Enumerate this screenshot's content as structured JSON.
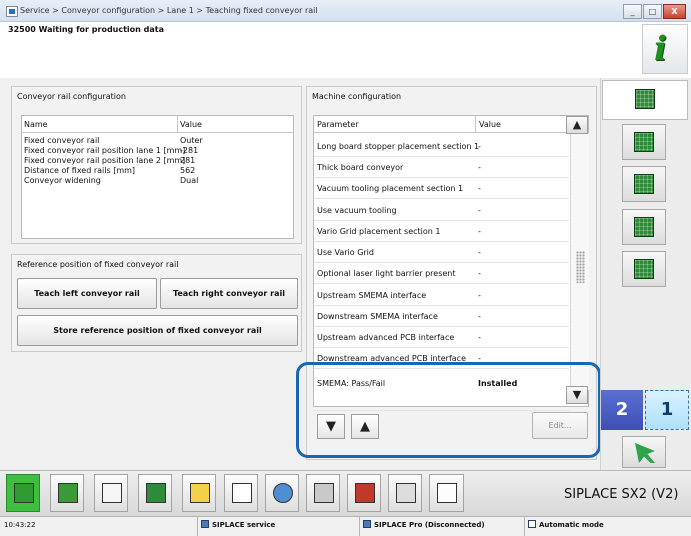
{
  "window": {
    "breadcrumb": "Service > Conveyor configuration > Lane 1 > Teaching fixed conveyor rail",
    "minimize_label": "_",
    "maximize_label": "□",
    "close_label": "X"
  },
  "status_message": "32500 Waiting for production data",
  "info_button_label": "i",
  "conveyor_config": {
    "title": "Conveyor rail configuration",
    "col_name": "Name",
    "col_value": "Value",
    "rows": [
      {
        "name": "Fixed conveyor rail",
        "value": "Outer"
      },
      {
        "name": "Fixed conveyor rail position lane 1 [mm]",
        "value": "-281"
      },
      {
        "name": "Fixed conveyor rail position lane 2 [mm]",
        "value": "281"
      },
      {
        "name": "Distance of fixed rails [mm]",
        "value": "562"
      },
      {
        "name": "Conveyor widening",
        "value": "Dual"
      }
    ]
  },
  "reference_position": {
    "title": "Reference position of fixed conveyor rail",
    "teach_left": "Teach left conveyor rail",
    "teach_right": "Teach right conveyor rail",
    "store": "Store reference position of fixed conveyor rail"
  },
  "machine_config": {
    "title": "Machine configuration",
    "col_param": "Parameter",
    "col_value": "Value",
    "rows": [
      {
        "param": "Long board stopper placement section 1",
        "value": "-"
      },
      {
        "param": "Thick board conveyor",
        "value": "-"
      },
      {
        "param": "Vacuum tooling placement section 1",
        "value": "-"
      },
      {
        "param": "Use vacuum tooling",
        "value": "-"
      },
      {
        "param": "Vario Grid placement section 1",
        "value": "-"
      },
      {
        "param": "Use Vario Grid",
        "value": "-"
      },
      {
        "param": "Optional laser light barrier present",
        "value": "-"
      },
      {
        "param": "Upstream SMEMA interface",
        "value": "-"
      },
      {
        "param": "Downstream SMEMA interface",
        "value": "-"
      },
      {
        "param": "Upstream advanced PCB interface",
        "value": "-"
      },
      {
        "param": "Downstream advanced PCB interface",
        "value": "-"
      },
      {
        "param": "SMEMA: Pass/Fail",
        "value": "Installed"
      }
    ],
    "edit_label": "Edit...",
    "move_down_glyph": "▼",
    "move_up_glyph": "▲",
    "scroll_up_glyph": "▲",
    "scroll_down_glyph": "▼"
  },
  "lanes": {
    "lane_2": "2",
    "lane_1": "1"
  },
  "brand": "SIPLACE SX2 (V2)",
  "statusbar": {
    "time": "10:43:22",
    "service": "SIPLACE service",
    "pro": "SIPLACE Pro (Disconnected)",
    "mode": "Automatic mode"
  },
  "icons": {
    "nav": [
      "conveyor-config-icon",
      "board-icon",
      "transfer-icon",
      "board-check-icon",
      "board-settings-icon"
    ],
    "toolbar": [
      "production-icon",
      "grid-icon",
      "chart-icon",
      "board-icon",
      "documents-icon",
      "trend-icon",
      "camera-icon",
      "oiling-icon",
      "tools-icon",
      "hand-gear-icon",
      "wrench-icon"
    ],
    "accent": "#1668b2"
  }
}
